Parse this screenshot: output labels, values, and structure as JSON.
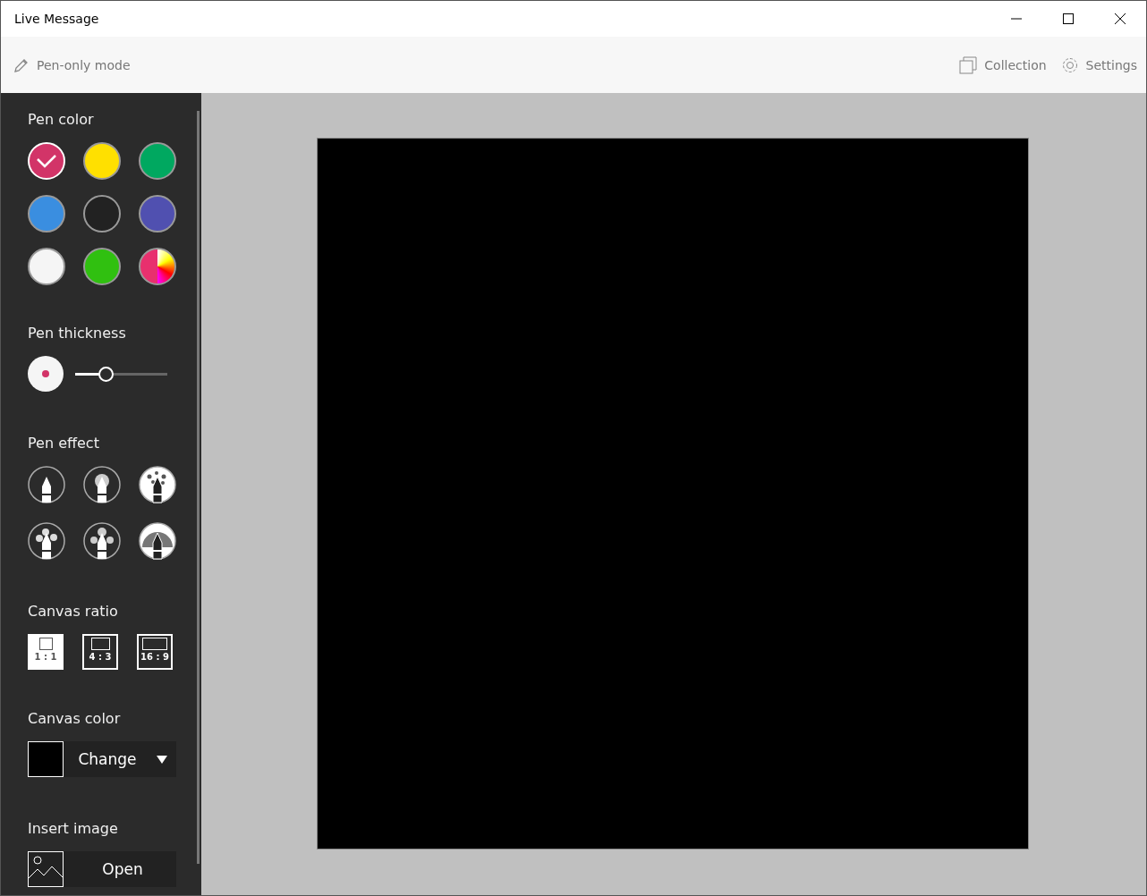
{
  "window": {
    "title": "Live Message"
  },
  "toolbar": {
    "pen_only_mode": "Pen-only mode",
    "collection": "Collection",
    "settings": "Settings"
  },
  "sidebar": {
    "pen_color": {
      "heading": "Pen color",
      "swatches": [
        {
          "kind": "solid",
          "color": "#d23468",
          "selected": true
        },
        {
          "kind": "solid",
          "color": "#ffe000",
          "selected": false
        },
        {
          "kind": "solid",
          "color": "#00a860",
          "selected": false
        },
        {
          "kind": "solid",
          "color": "#3a8ee0",
          "selected": false
        },
        {
          "kind": "solid",
          "color": "#222222",
          "selected": false
        },
        {
          "kind": "solid",
          "color": "#5050b0",
          "selected": false
        },
        {
          "kind": "solid",
          "color": "#f5f5f5",
          "selected": false
        },
        {
          "kind": "solid",
          "color": "#30c010",
          "selected": false
        },
        {
          "kind": "picker",
          "color": "#e8306e",
          "selected": false
        }
      ]
    },
    "pen_thickness": {
      "heading": "Pen thickness",
      "level": 0.34
    },
    "pen_effect": {
      "heading": "Pen effect",
      "effects": [
        {
          "kind": "plain"
        },
        {
          "kind": "glow"
        },
        {
          "kind": "dots"
        },
        {
          "kind": "hearts"
        },
        {
          "kind": "snowflakes"
        },
        {
          "kind": "rainbow"
        }
      ]
    },
    "canvas_ratio": {
      "heading": "Canvas ratio",
      "ratios": [
        {
          "label": "1 : 1",
          "kind": "square",
          "selected": true
        },
        {
          "label": "4 : 3",
          "kind": "standard",
          "selected": false
        },
        {
          "label": "16 : 9",
          "kind": "wide",
          "selected": false
        }
      ]
    },
    "canvas_color": {
      "heading": "Canvas color",
      "color": "#000000",
      "button": "Change"
    },
    "insert_image": {
      "heading": "Insert image",
      "button": "Open"
    }
  }
}
